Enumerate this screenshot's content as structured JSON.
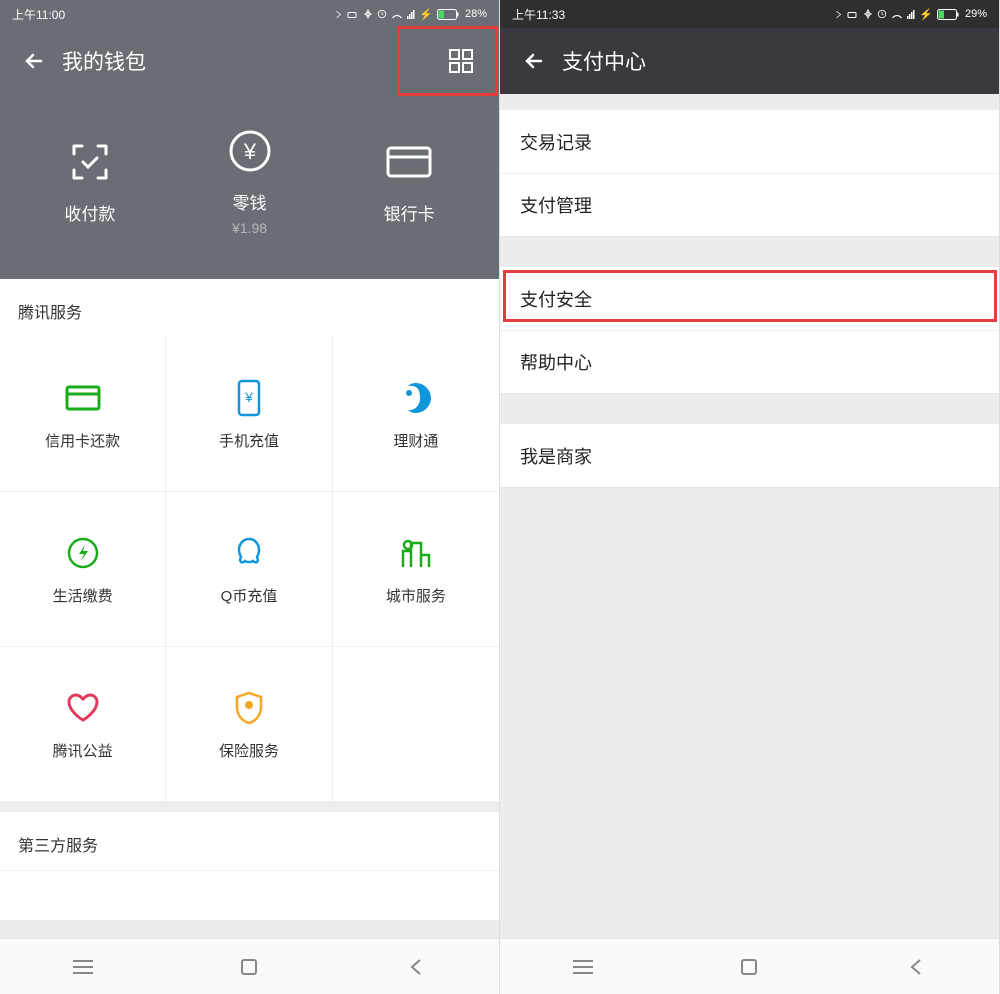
{
  "left": {
    "status": {
      "time": "上午11:00",
      "battery": "28%"
    },
    "nav": {
      "title": "我的钱包"
    },
    "hero": [
      {
        "label": "收付款",
        "sub": ""
      },
      {
        "label": "零钱",
        "sub": "¥1.98"
      },
      {
        "label": "银行卡",
        "sub": ""
      }
    ],
    "sections": {
      "tencent": "腾讯服务",
      "thirdparty": "第三方服务"
    },
    "services": [
      {
        "label": "信用卡还款",
        "color": "#1aad19"
      },
      {
        "label": "手机充值",
        "color": "#1296db"
      },
      {
        "label": "理财通",
        "color": "#1296db"
      },
      {
        "label": "生活缴费",
        "color": "#1aad19"
      },
      {
        "label": "Q币充值",
        "color": "#1296db"
      },
      {
        "label": "城市服务",
        "color": "#1aad19"
      },
      {
        "label": "腾讯公益",
        "color": "#e2395e"
      },
      {
        "label": "保险服务",
        "color": "#f5a623"
      }
    ]
  },
  "right": {
    "status": {
      "time": "上午11:33",
      "battery": "29%"
    },
    "nav": {
      "title": "支付中心"
    },
    "groups": [
      [
        "交易记录",
        "支付管理"
      ],
      [
        "支付安全",
        "帮助中心"
      ],
      [
        "我是商家"
      ]
    ]
  }
}
